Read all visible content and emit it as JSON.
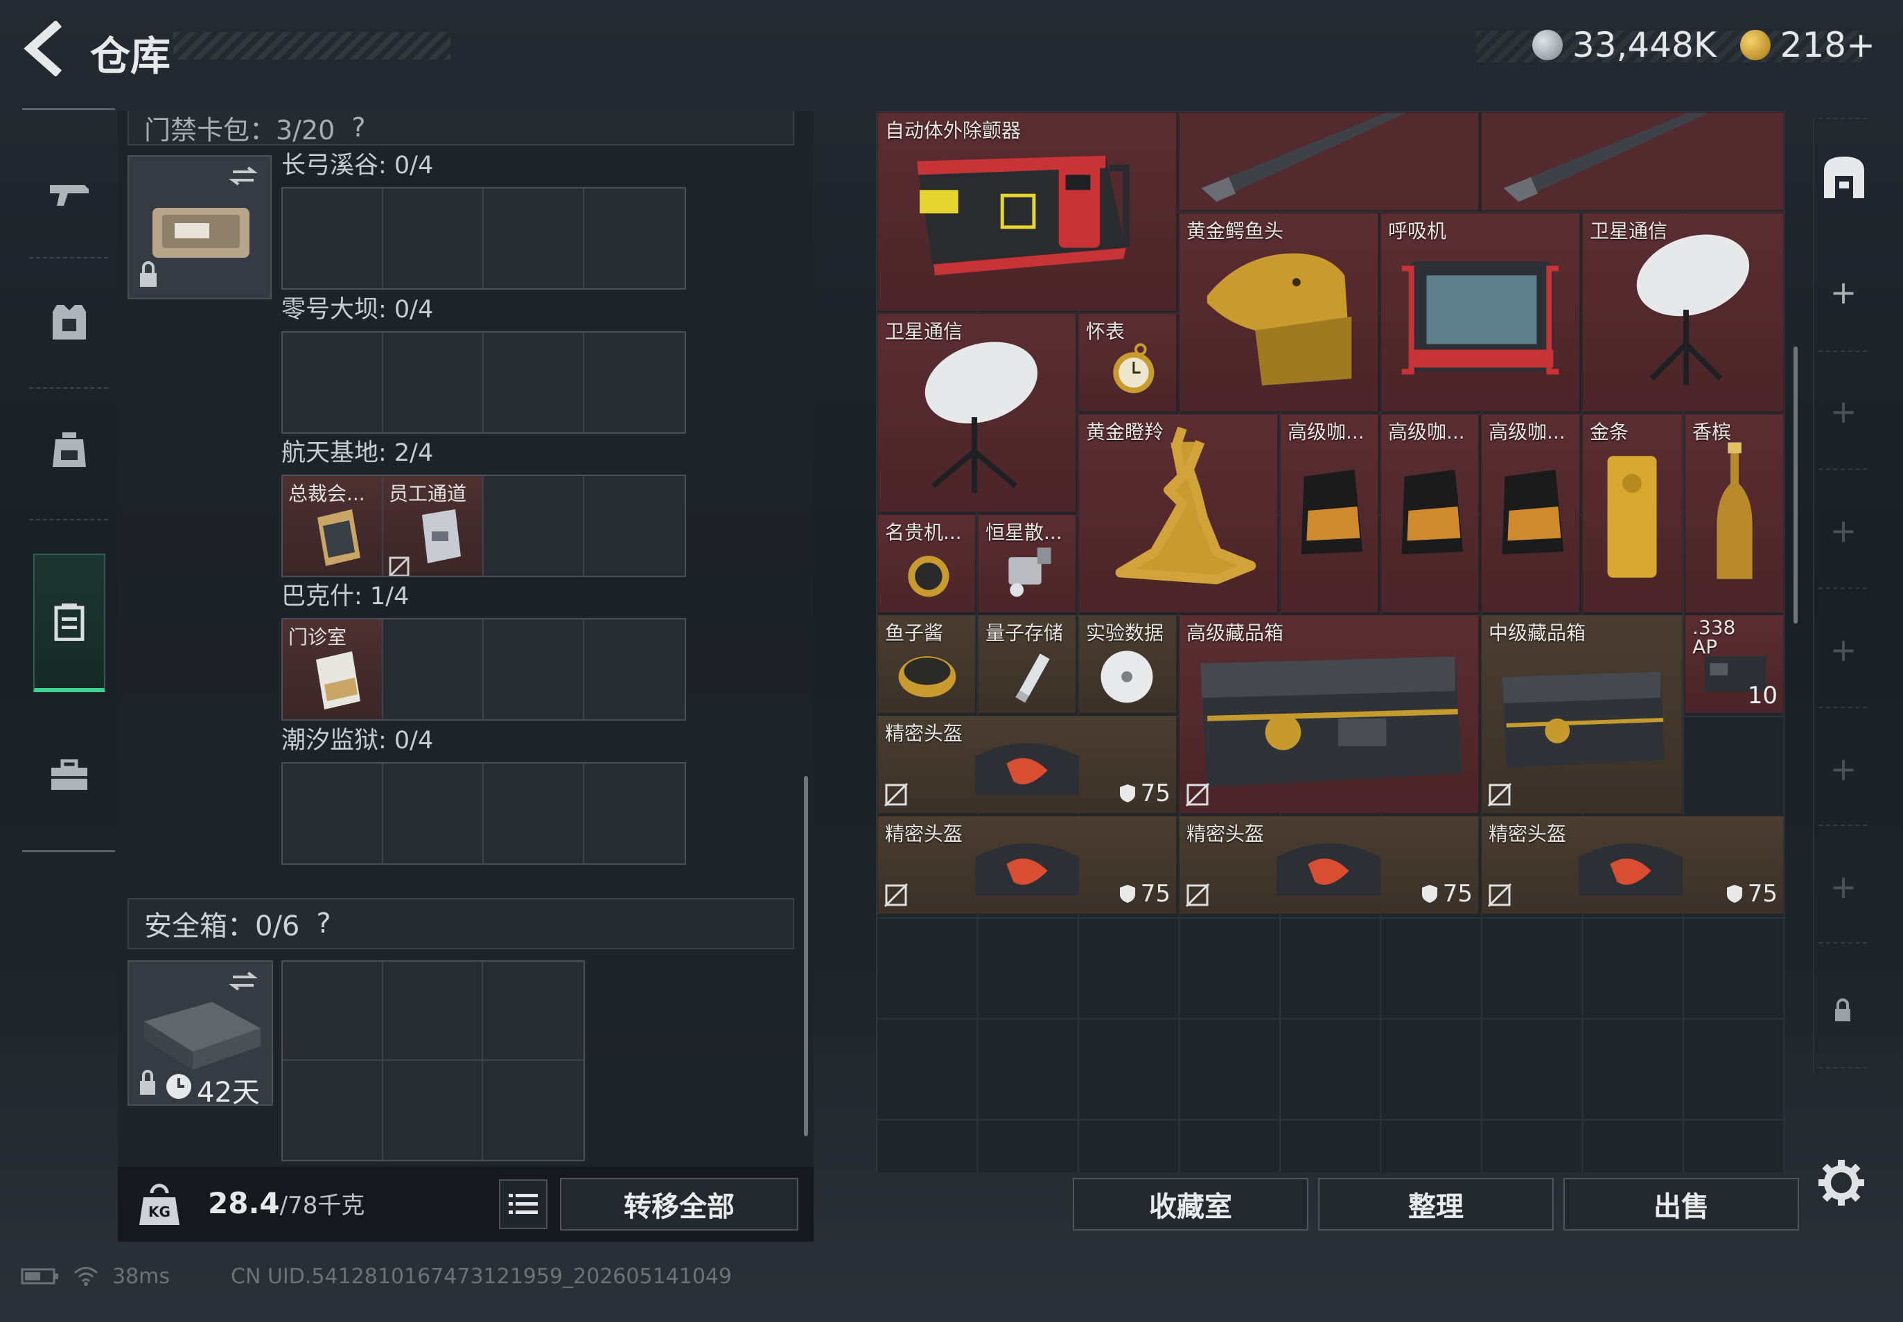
{
  "header": {
    "title": "仓库",
    "currency_silver": "33,448K",
    "currency_gold": "218+"
  },
  "side_nav": [
    {
      "name": "weapons",
      "icon": "rifle-icon"
    },
    {
      "name": "armor",
      "icon": "vest-icon"
    },
    {
      "name": "backpack",
      "icon": "backpack-icon"
    },
    {
      "name": "container",
      "icon": "container-icon",
      "active": true
    },
    {
      "name": "toolbox",
      "icon": "briefcase-icon"
    }
  ],
  "left": {
    "keycard_header": "门禁卡包：3/20",
    "keycard_groups": [
      {
        "label": "长弓溪谷: 0/4",
        "cards": []
      },
      {
        "label": "零号大坝: 0/4",
        "cards": []
      },
      {
        "label": "航天基地: 2/4",
        "cards": [
          "总裁会...",
          "员工通道"
        ]
      },
      {
        "label": "巴克什: 1/4",
        "cards": [
          "门诊室"
        ]
      },
      {
        "label": "潮汐监狱: 0/4",
        "cards": []
      }
    ],
    "safebox_header": "安全箱：0/6",
    "safebox_time": "42天",
    "weight_value": "28.4",
    "weight_unit": "/78千克",
    "transfer_all": "转移全部"
  },
  "stash": {
    "items": {
      "aed": "自动体外除颤器",
      "croc": "黄金鳄鱼头",
      "resp": "呼吸机",
      "sat1": "卫星通信",
      "sat2": "卫星通信",
      "watch": "怀表",
      "antelope": "黄金瞪羚",
      "coffee1": "高级咖...",
      "coffee2": "高级咖...",
      "coffee3": "高级咖...",
      "goldbar": "金条",
      "champagne": "香槟",
      "luxwatch": "名贵机...",
      "star": "恒星散...",
      "caviar": "鱼子酱",
      "quantum": "量子存储",
      "expdata": "实验数据",
      "hcase": "高级藏品箱",
      "mcase": "中级藏品箱",
      "ammo": ".338 AP",
      "ammo_qty": "10",
      "helm1": "精密头盔",
      "helm2": "精密头盔",
      "helm3": "精密头盔",
      "helm4": "精密头盔",
      "helm_dur": "75"
    },
    "buttons": {
      "collection": "收藏室",
      "sort": "整理",
      "sell": "出售"
    }
  },
  "status": {
    "ping": "38ms",
    "uid": "CN UID.5412810167473121959_202605141049"
  },
  "colors": {
    "accent_green": "#3fd18f",
    "item_red": "#532a2e",
    "item_brown": "#4a3d31"
  }
}
